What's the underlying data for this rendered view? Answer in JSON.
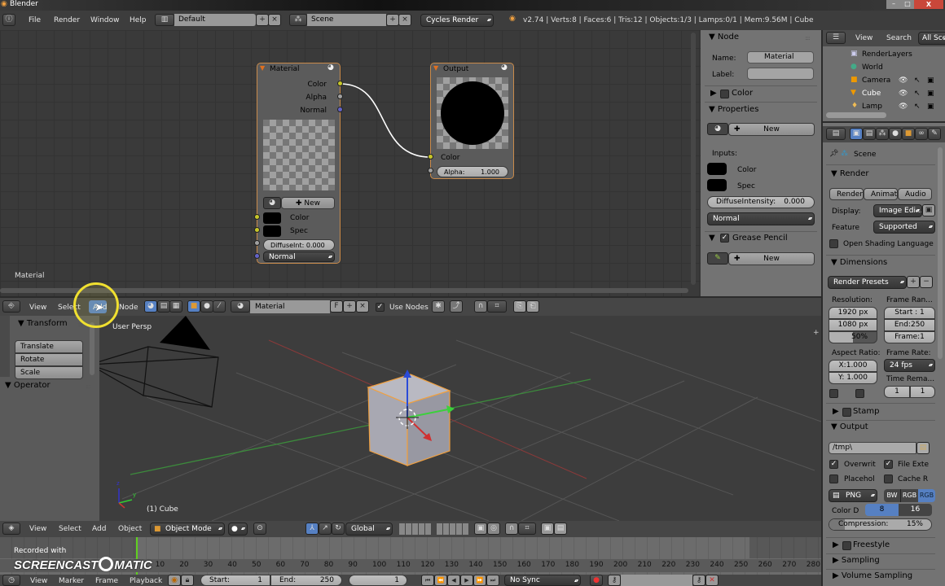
{
  "window": {
    "title": "Blender",
    "min": "–",
    "max": "□",
    "close": "X"
  },
  "info_header": {
    "menus": [
      "File",
      "Render",
      "Window",
      "Help"
    ],
    "layout": "Default",
    "scene": "Scene",
    "engine": "Cycles Render",
    "stats": "v2.74 | Verts:8 | Faces:6 | Tris:12 | Objects:1/3 | Lamps:0/1 | Mem:9.56M | Cube"
  },
  "node_editor": {
    "area_label": "Material",
    "material_node": {
      "title": "Material",
      "outputs": [
        "Color",
        "Alpha",
        "Normal"
      ],
      "new_label": "New",
      "inputs": [
        "Color",
        "Spec"
      ],
      "diffuse": "DiffuseInt: 0.000",
      "normal": "Normal"
    },
    "output_node": {
      "title": "Output",
      "input": "Color",
      "alpha": "Alpha:",
      "alpha_value": "1.000"
    },
    "header": {
      "menus": [
        "View",
        "Select",
        "Add",
        "Node"
      ],
      "material": "Material",
      "fake_user": "F",
      "use_nodes": "Use Nodes"
    }
  },
  "node_panel": {
    "node_title": "Node",
    "name_label": "Name:",
    "name_value": "Material",
    "label_label": "Label:",
    "color_title": "Color",
    "properties_title": "Properties",
    "new_label": "New",
    "inputs_label": "Inputs:",
    "inputs": [
      "Color",
      "Spec"
    ],
    "diffuse_label": "DiffuseIntensity:",
    "diffuse_value": "0.000",
    "normal": "Normal",
    "grease_title": "Grease Pencil",
    "grease_new": "New"
  },
  "outliner": {
    "menus": [
      "View",
      "Search"
    ],
    "filter": "All Scenes",
    "items": [
      "RenderLayers",
      "World",
      "Camera",
      "Cube",
      "Lamp"
    ]
  },
  "properties": {
    "context": "Scene",
    "render_title": "Render",
    "render_buttons": [
      "Render",
      "Animation",
      "Audio"
    ],
    "display_label": "Display:",
    "display_value": "Image Edi...",
    "feature_label": "Feature",
    "feature_value": "Supported",
    "osl_label": "Open Shading Language",
    "dimensions_title": "Dimensions",
    "render_presets": "Render Presets",
    "resolution_label": "Resolution:",
    "res_x": "1920 px",
    "res_y": "1080 px",
    "res_pct": "50%",
    "res_pct_value": 50,
    "frame_range_label": "Frame Ran...",
    "start": "Start : 1",
    "end": "End:250",
    "frame": "Frame:1",
    "aspect_label": "Aspect Ratio:",
    "aspect_x": "X:1.000",
    "aspect_y": "Y: 1.000",
    "frame_rate_label": "Frame Rate:",
    "fps": "24 fps",
    "time_remap_label": "Time Rema...",
    "remap_old": "1",
    "remap_new": "1",
    "stamp_title": "Stamp",
    "output_title": "Output",
    "output_path": "/tmp\\",
    "overwrite": "Overwrit",
    "file_ext": "File Exte",
    "placeholders": "Placehol",
    "cache": "Cache R",
    "format": "PNG",
    "color_modes": [
      "BW",
      "RGB",
      "RGB"
    ],
    "color_depth_label": "Color D",
    "depths": [
      "8",
      "16"
    ],
    "compression_label": "Compression:",
    "compression_value": "15%",
    "compression_pct": 15,
    "freestyle_title": "Freestyle",
    "sampling_title": "Sampling",
    "volume_title": "Volume Sampling"
  },
  "viewport": {
    "view_name": "User Persp",
    "object_label": "(1) Cube",
    "toolshelf": {
      "transform_title": "Transform",
      "buttons": [
        "Translate",
        "Rotate",
        "Scale"
      ],
      "operator_title": "Operator"
    },
    "header": {
      "menus": [
        "View",
        "Select",
        "Add",
        "Object"
      ],
      "mode": "Object Mode",
      "orientation": "Global"
    },
    "axis": {
      "z": "z",
      "y": "y"
    }
  },
  "timeline": {
    "ruler": [
      "10",
      "20",
      "30",
      "40",
      "50",
      "60",
      "70",
      "80",
      "90",
      "100",
      "110",
      "120",
      "130",
      "140",
      "150",
      "160",
      "170",
      "180",
      "190",
      "200",
      "210",
      "220",
      "230",
      "240",
      "250",
      "260",
      "270",
      "280"
    ],
    "header": {
      "menus": [
        "View",
        "Marker",
        "Frame",
        "Playback"
      ],
      "start_label": "Start:",
      "start_value": "1",
      "end_label": "End:",
      "end_value": "250",
      "current": "1",
      "sync": "No Sync"
    }
  },
  "watermark": {
    "line1": "Recorded with",
    "line2": "SCREENCAST",
    "line3": "MATIC"
  },
  "colors": {
    "accent_blue": "#5680c2",
    "node_border": "#c98a4a",
    "socket_yellow": "#c7c729",
    "socket_gray": "#a1a1a1",
    "socket_blue": "#6363c7"
  }
}
